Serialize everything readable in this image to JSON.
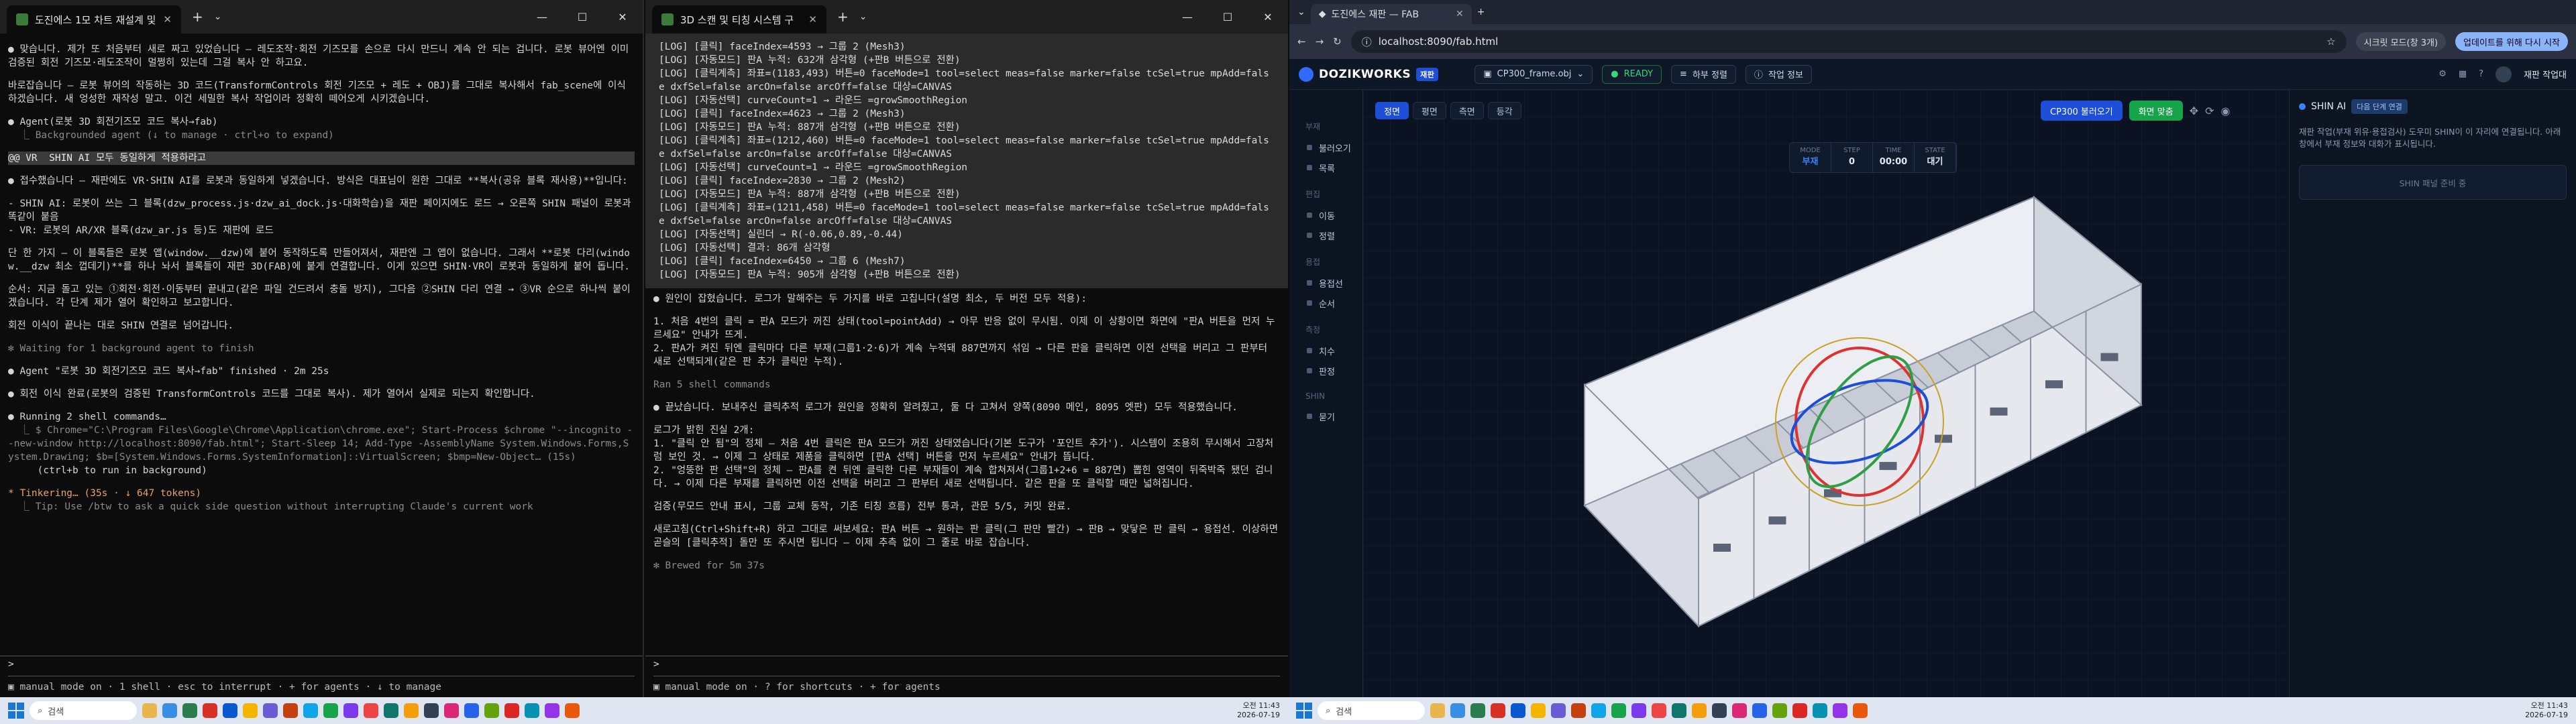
{
  "term1": {
    "tab_title": "도진에스 1모 차트 재설계 및",
    "lines": [
      "● 맞습니다. 제가 또 처음부터 새로 짜고 있었습니다 — 레도조작·회전 기즈모를 손으로 다시 만드니 계속 안 되는 겁니다. 로봇 뷰어엔 이미 검증된 회전 기즈모·레도조작이 멀쩡히 있는데 그걸 복사 안 하고요.",
      "",
      "바로잡습니다 — 로봇 뷰어의 작동하는 3D 코드(TransformControls 회전 기즈모 + 레도 + OBJ)를 그대로 복사해서 fab_scene에 이식하겠습니다. 새 엉성한 재작성 말고. 이건 세밀한 복사 작업이라 정확히 떼어오게 시키겠습니다.",
      "",
      "● Agent(로봇 3D 회전기즈모 코드 복사→fab)",
      "  ⎿ Backgrounded agent (↓ to manage · ctrl+o to expand)",
      "",
      "@@ VR  SHIN AI 모두 동일하게 적용하라고",
      "",
      "● 접수했습니다 — 재판에도 VR·SHIN AI를 로봇과 동일하게 넣겠습니다. 방식은 대표님이 원한 그대로 **복사(공유 블록 재사용)**입니다:",
      "",
      "- SHIN AI: 로봇이 쓰는 그 블록(dzw_process.js·dzw_ai_dock.js·대화학습)을 재판 페이지에도 로드 → 오른쪽 SHIN 패널이 로봇과 똑같이 붙음",
      "- VR: 로봇의 AR/XR 블록(dzw_ar.js 등)도 재판에 로드",
      "",
      "단 한 가지 — 이 블록들은 로봇 앱(window.__dzw)에 붙어 동작하도록 만들어져서, 재판엔 그 앱이 없습니다. 그래서 **로봇 다리(window.__dzw 최소 껍데기)**를 하나 놔서 블록들이 재판 3D(FAB)에 붙게 연결합니다. 이게 있으면 SHIN·VR이 로봇과 동일하게 붙어 돕니다.",
      "",
      "순서: 지금 돌고 있는 ①회전·회전·이동부터 끝내고(같은 파일 건드려서 충돌 방지), 그다음 ②SHIN 다리 연결 → ③VR 순으로 하나씩 붙이겠습니다. 각 단계 제가 열어 확인하고 보고합니다.",
      "",
      "회전 이식이 끝나는 대로 SHIN 연결로 넘어갑니다.",
      "",
      "✻ Waiting for 1 background agent to finish",
      "",
      "● Agent \"로봇 3D 회전기즈모 코드 복사→fab\" finished · 2m 25s",
      "",
      "● 회전 이식 완료(로봇의 검증된 TransformControls 코드를 그대로 복사). 제가 열어서 실제로 되는지 확인합니다.",
      "",
      "● Running 2 shell commands…",
      "  ⎿ $ Chrome=\"C:\\Program Files\\Google\\Chrome\\Application\\chrome.exe\"; Start-Process $chrome \"--incognito --new-window http://localhost:8090/fab.html\"; Start-Sleep 14; Add-Type -AssemblyName System.Windows.Forms,System.Drawing; $b=[System.Windows.Forms.SystemInformation]::VirtualScreen; $bmp=New-Object… (15s)",
      "     (ctrl+b to run in background)",
      "",
      "* Tinkering… (35s · ↓ 647 tokens)",
      "  ⎿ Tip: Use /btw to ask a quick side question without interrupting Claude's current work"
    ],
    "prompt": ">",
    "status": "▣ manual mode on · 1 shell · esc to interrupt · + for agents · ↓ to manage"
  },
  "term2": {
    "tab_title": "3D 스캔 및 티칭 시스템 구",
    "log": [
      "[LOG] [클릭] faceIndex=4593 → 그룹 2 (Mesh3)",
      "[LOG] [자동모드] 판A 누적: 632개 삼각형 (+판B 버튼으로 전환)",
      "[LOG] [클릭계측] 좌표=(1183,493) 버튼=0 faceMode=1 tool=select meas=false marker=false tcSel=true mpAdd=false dxfSel=false arcOn=false arcOff=false 대상=CANVAS",
      "[LOG] [자동선택] curveCount=1 → 라운드 =growSmoothRegion",
      "[LOG] [클릭] faceIndex=4623 → 그룹 2 (Mesh3)",
      "[LOG] [자동모드] 판A 누적: 887개 삼각형 (+판B 버튼으로 전환)",
      "[LOG] [클릭계측] 좌표=(1212,460) 버튼=0 faceMode=1 tool=select meas=false marker=false tcSel=true mpAdd=false dxfSel=false arcOn=false arcOff=false 대상=CANVAS",
      "[LOG] [자동선택] curveCount=1 → 라운드 =growSmoothRegion",
      "[LOG] [클릭] faceIndex=2830 → 그룹 2 (Mesh2)",
      "[LOG] [자동모드] 판A 누적: 887개 삼각형 (+판B 버튼으로 전환)",
      "[LOG] [클릭계측] 좌표=(1211,458) 버튼=0 faceMode=1 tool=select meas=false marker=false tcSel=true mpAdd=false dxfSel=false arcOn=false arcOff=false 대상=CANVAS",
      "[LOG] [자동선택] 실린더 → R(-0.06,0.89,-0.44)",
      "[LOG] [자동선택] 결과: 86개 삼각형",
      "[LOG] [클릭] faceIndex=6450 → 그룹 6 (Mesh7)",
      "[LOG] [자동모드] 판A 누적: 905개 삼각형 (+판B 버튼으로 전환)"
    ],
    "lines": [
      "● 원인이 잡혔습니다. 로그가 말해주는 두 가지를 바로 고칩니다(설명 최소, 두 버전 모두 적용):",
      "",
      "1. 처음 4번의 클릭 = 판A 모드가 꺼진 상태(tool=pointAdd) → 아무 반응 없이 무시됨. 이제 이 상황이면 화면에 \"판A 버튼을 먼저 누르세요\" 안내가 뜨게.",
      "2. 판A가 켜진 뒤엔 클릭마다 다른 부재(그룹1·2·6)가 계속 누적돼 887면까지 섞임 → 다른 판을 클릭하면 이전 선택을 버리고 그 판부터 새로 선택되게(같은 판 추가 클릭만 누적).",
      "",
      "Ran 5 shell commands",
      "",
      "● 끝났습니다. 보내주신 클릭추적 로그가 원인을 정확히 알려줬고, 둘 다 고쳐서 양쪽(8090 메인, 8095 엣판) 모두 적용했습니다.",
      "",
      "로그가 밝힌 진실 2개:",
      "1. \"클릭 안 됨\"의 정체 — 처음 4번 클릭은 판A 모드가 꺼진 상태였습니다(기본 도구가 '포인트 추가'). 시스템이 조용히 무시해서 고장처럼 보인 것. → 이제 그 상태로 제품을 클릭하면 [판A 선택] 버튼을 먼저 누르세요\" 안내가 뜹니다.",
      "2. \"엉뚱한 판 선택\"의 정체 — 판A를 켠 뒤엔 클릭한 다른 부재들이 계속 합쳐져서(그룹1+2+6 = 887면) 뽑힌 영역이 뒤죽박죽 됐던 겁니다. → 이제 다른 부재를 클릭하면 이전 선택을 버리고 그 판부터 새로 선택됩니다. 같은 판을 또 클릭할 때만 넓혀집니다.",
      "",
      "검증(무모드 안내 표시, 그룹 교체 동작, 기존 티칭 흐름) 전부 통과, 관문 5/5, 커밋 완료.",
      "",
      "새로고침(Ctrl+Shift+R) 하고 그대로 써보세요: 판A 버튼 → 원하는 판 클릭(그 판만 빨간) → 판B → 맞닿은 판 클릭 → 용접선. 이상하면 곧슬의 [클릭추적] 돌만 또 주시면 됩니다 — 이제 추측 없이 그 줄로 바로 잡습니다.",
      "",
      "✻ Brewed for 5m 37s"
    ],
    "prompt": ">",
    "status": "▣ manual mode on · ? for shortcuts · + for agents"
  },
  "browser": {
    "tab_title": "도진에스 재판 — FAB",
    "url": "localhost:8090/fab.html",
    "bookmarks": [
      "시크릿 모드(창 3개)",
      "업데이트를 위해 다시 시작"
    ],
    "app": {
      "brand": "DOZIKWORKS",
      "brand_tag": "재판",
      "file": "CP300_frame.obj",
      "ready": "READY",
      "chip1": "하부 정렬",
      "chip2": "작업 정보",
      "user": "재판 작업대"
    },
    "side": {
      "sections": [
        {
          "title": "부재",
          "items": [
            "불러오기",
            "목록"
          ]
        },
        {
          "title": "편집",
          "items": [
            "이동",
            "정렬"
          ]
        },
        {
          "title": "용접",
          "items": [
            "용접선",
            "순서"
          ]
        },
        {
          "title": "측정",
          "items": [
            "치수",
            "판정"
          ]
        },
        {
          "title": "SHIN",
          "items": [
            "묻기"
          ]
        }
      ]
    },
    "view_tabs": [
      "정면",
      "평면",
      "측면",
      "등각"
    ],
    "actions": {
      "btn1": "CP300 불러오기",
      "btn2": "화면 맞춤"
    },
    "stats": [
      {
        "k": "MODE",
        "v": "부재"
      },
      {
        "k": "STEP",
        "v": "0"
      },
      {
        "k": "TIME",
        "v": "00:00"
      },
      {
        "k": "STATE",
        "v": "대기"
      }
    ],
    "right": {
      "title": "SHIN AI",
      "tag": "다음 단계 연결",
      "text": "재판 작업(부재 위유·용접검사) 도우미 SHIN이 이 자리에 연결됩니다. 아래 창에서 부재 정보와 대화가 표시됩니다.",
      "box": "SHIN 패널 준비 중"
    }
  },
  "taskbar": {
    "search": "검색",
    "time": "오전 11:43",
    "date": "2026-07-19"
  },
  "colors": {
    "accent": "#1d4ed8",
    "ready": "#37d67a",
    "frame": "#e6e8ee"
  }
}
